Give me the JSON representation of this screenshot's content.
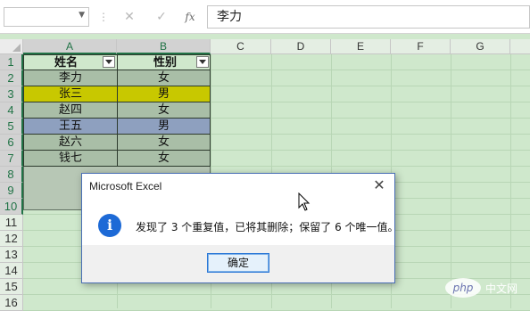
{
  "formula_bar": {
    "name_box": "",
    "cancel_glyph": "✕",
    "enter_glyph": "✓",
    "fx_label": "fx",
    "content": "李力"
  },
  "columns": [
    "A",
    "B",
    "C",
    "D",
    "E",
    "F",
    "G"
  ],
  "rows": [
    "1",
    "2",
    "3",
    "4",
    "5",
    "6",
    "7",
    "8",
    "9",
    "10",
    "11",
    "12",
    "13",
    "14",
    "15",
    "16"
  ],
  "table": {
    "headers": [
      "姓名",
      "性别"
    ],
    "rows": [
      {
        "name": "李力",
        "gender": "女",
        "fill": "#a9bea7"
      },
      {
        "name": "张三",
        "gender": "男",
        "fill": "#c8c800"
      },
      {
        "name": "赵四",
        "gender": "女",
        "fill": "#a9bea7"
      },
      {
        "name": "王五",
        "gender": "男",
        "fill": "#8ea0bf"
      },
      {
        "name": "赵六",
        "gender": "女",
        "fill": "#a9bea7"
      },
      {
        "name": "钱七",
        "gender": "女",
        "fill": "#a9bea7"
      }
    ]
  },
  "dialog": {
    "title": "Microsoft Excel",
    "close_glyph": "✕",
    "icon_glyph": "i",
    "message": "发现了 3 个重复值，已将其删除；保留了 6 个唯一值。",
    "ok_label": "确定"
  },
  "colors": {
    "sheet_bg": "#cfe8cc",
    "header_fill": "#e4eee3",
    "selected_header": "#217346",
    "info_icon": "#1d6ad6"
  },
  "icons": [
    "dropdown-arrow-icon",
    "cancel-icon",
    "enter-icon",
    "function-icon",
    "select-all-icon",
    "filter-dropdown-icon",
    "info-icon",
    "close-icon",
    "mouse-cursor-icon"
  ],
  "watermark": {
    "brand": "php",
    "site": "中文网"
  }
}
